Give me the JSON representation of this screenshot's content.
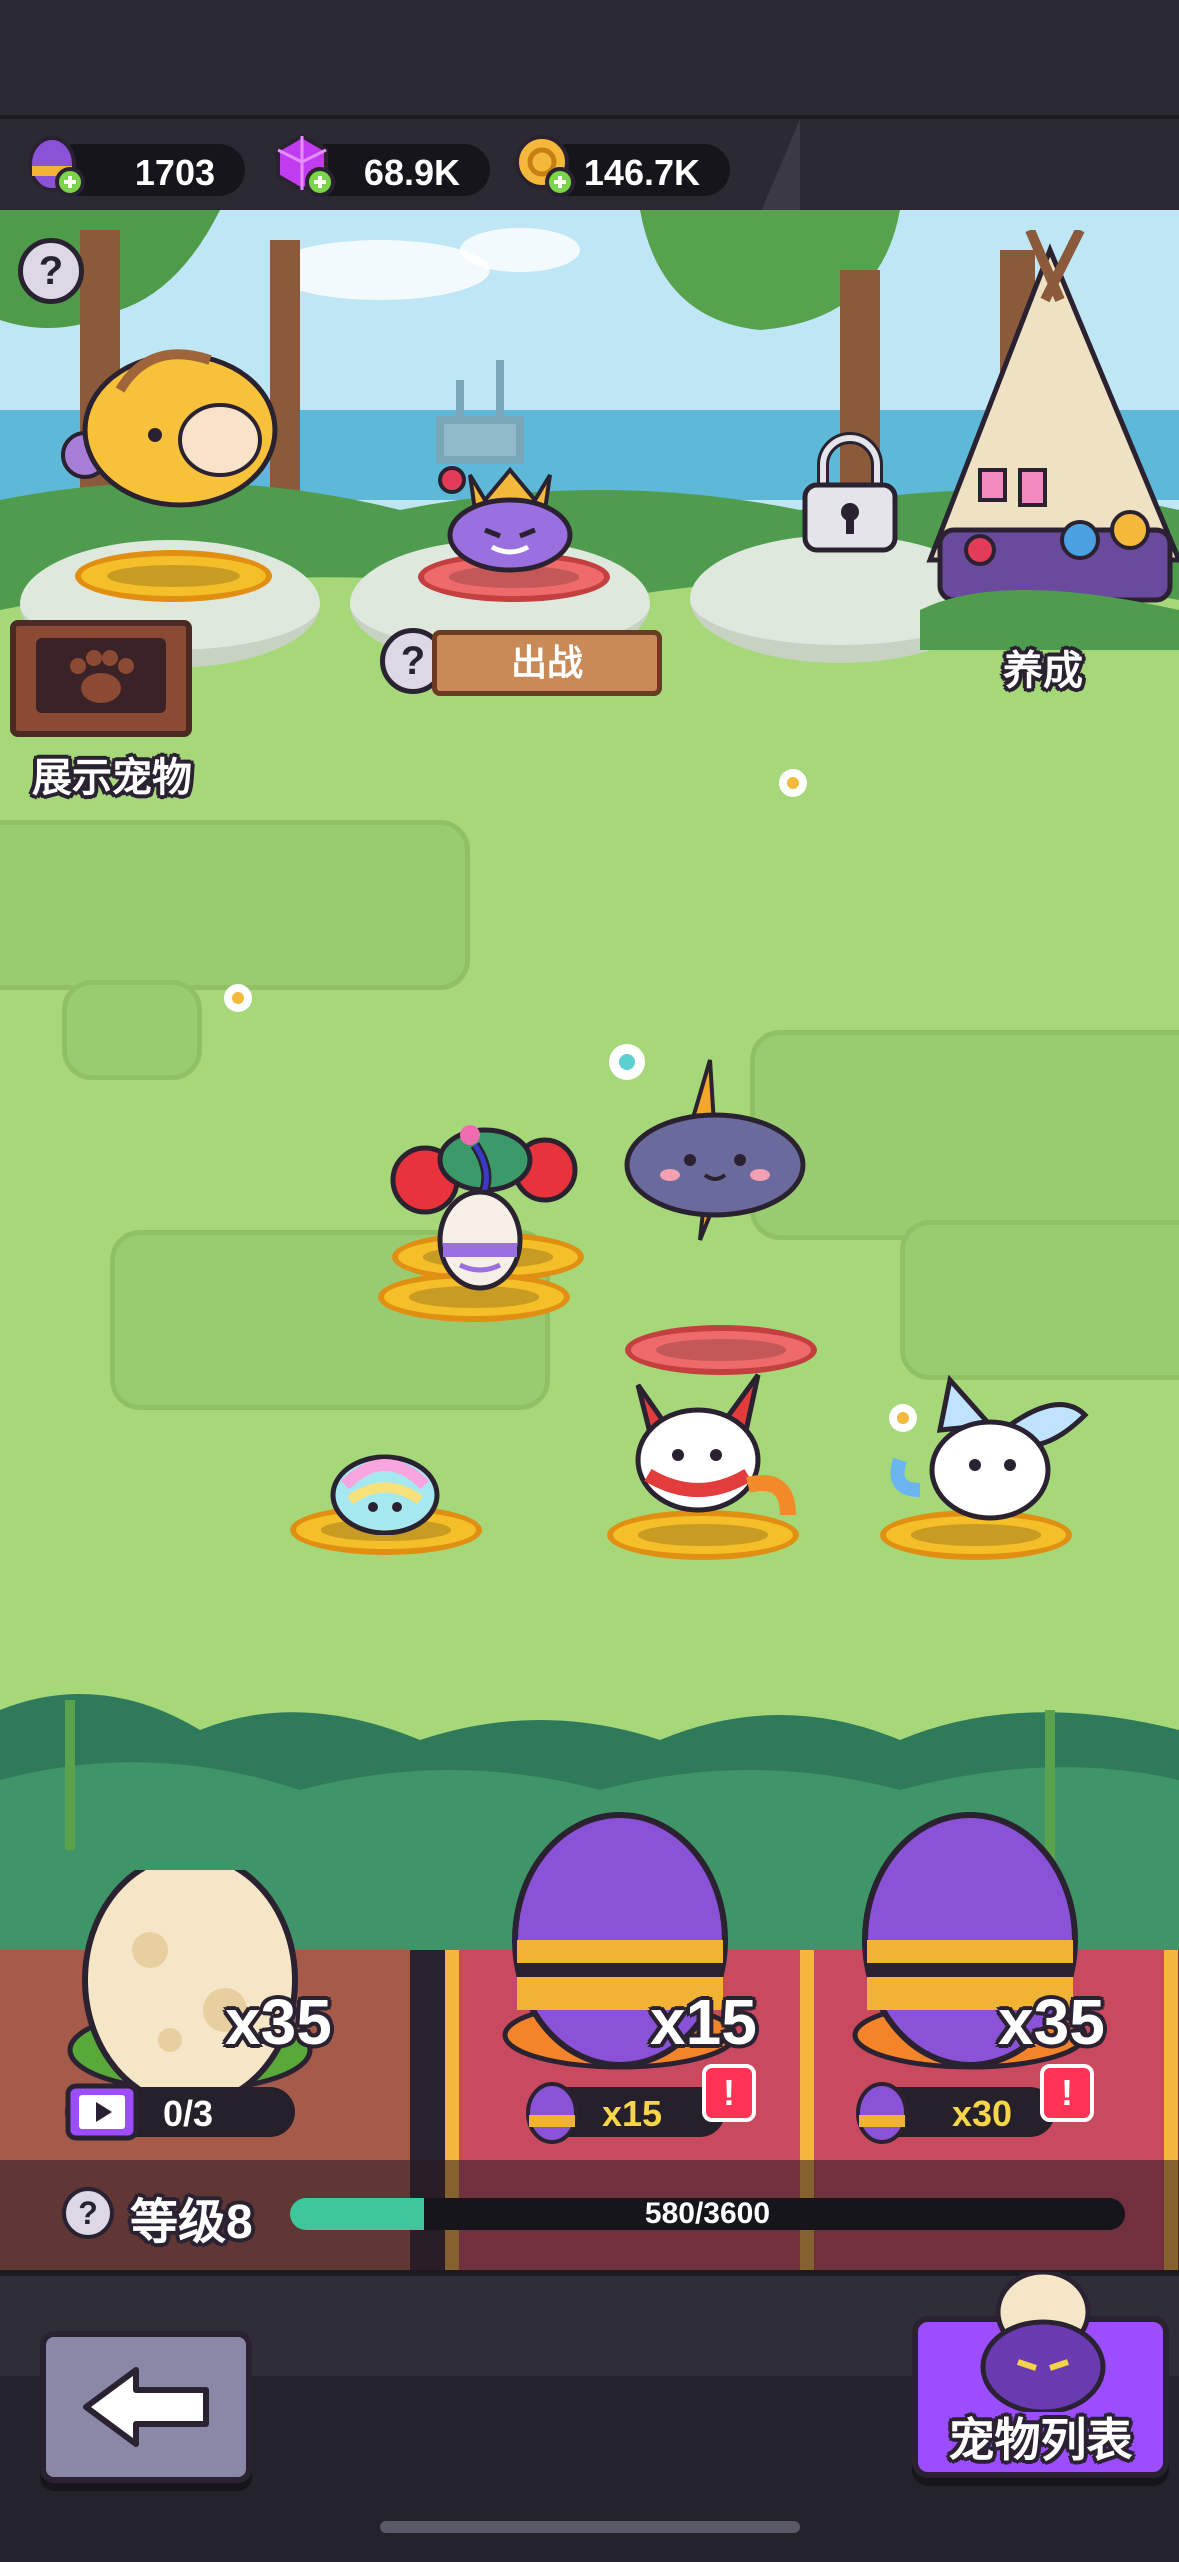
{
  "resources": [
    {
      "icon": "purple-egg-plus-icon",
      "value": "1703"
    },
    {
      "icon": "purple-gem-plus-icon",
      "value": "68.9K"
    },
    {
      "icon": "gold-coin-plus-icon",
      "value": "146.7K"
    }
  ],
  "scene": {
    "display_pets_label": "展示宠物",
    "battle_label": "出战",
    "nurture_label": "养成"
  },
  "eggs": [
    {
      "count": "x35",
      "video_progress": "0/3"
    },
    {
      "count": "x15",
      "cost": "x15"
    },
    {
      "count": "x35",
      "cost": "x30"
    }
  ],
  "level": {
    "label": "等级8",
    "progress_text": "580/3600",
    "progress": 0.161
  },
  "buttons": {
    "pet_list": "宠物列表"
  },
  "colors": {
    "accent": "#9c4dff",
    "progress": "#3ec79a",
    "shop_gold": "#f4b63c",
    "shop_red": "#c94a5f"
  }
}
